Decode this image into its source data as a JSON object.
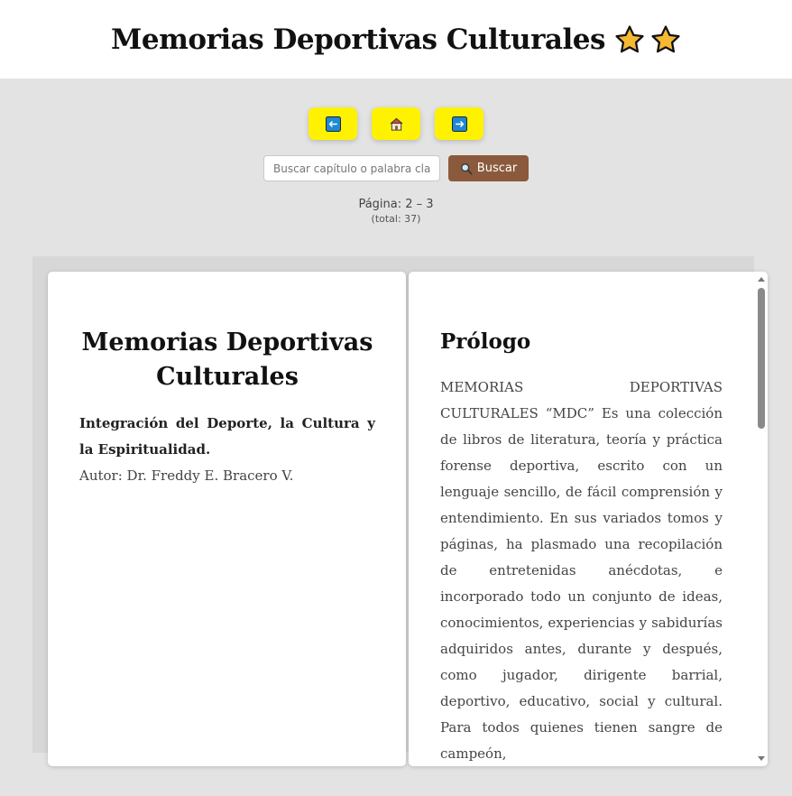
{
  "header": {
    "title": "Memorias Deportivas Culturales",
    "icons": [
      "star-icon",
      "star-icon"
    ],
    "star_color": "#f5b833"
  },
  "nav": {
    "prev_icon": "left-arrow-icon",
    "home_icon": "house-icon",
    "next_icon": "right-arrow-icon",
    "button_color": "#fff200"
  },
  "search": {
    "placeholder": "Buscar capítulo o palabra clave",
    "value": "",
    "button_label": "Buscar",
    "button_icon": "magnifier-icon",
    "button_color": "#8b5a3c"
  },
  "pagination": {
    "current": "Página: 2 – 3",
    "total": "(total: 37)"
  },
  "book": {
    "left_page": {
      "title": "Memorias Deportivas Culturales",
      "subtitle": "Integración del Deporte, la Cultura y la Espiritualidad.",
      "author": "Autor: Dr. Freddy E. Bracero V."
    },
    "right_page": {
      "title": "Prólogo",
      "text": "MEMORIAS DEPORTIVAS CULTURALES “MDC” Es una colección de libros de literatura, teoría y práctica forense deportiva, escrito con un lenguaje sencillo, de fácil comprensión y entendimiento. En sus variados tomos y páginas, ha plasmado una recopilación de entretenidas anécdotas, e incorporado todo un conjunto de ideas, conocimientos, experiencias y sabidurías adquiridos antes, durante y después, como jugador, dirigente barrial, deportivo, educativo, social y cultural. Para todos quienes tienen sangre de campeón,"
    }
  }
}
